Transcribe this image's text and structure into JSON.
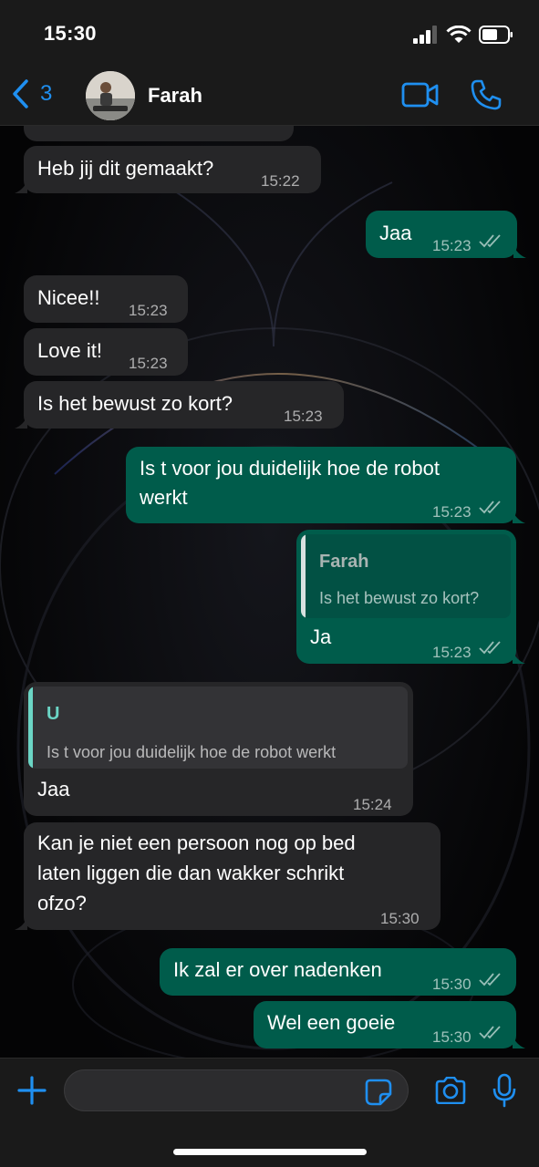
{
  "status_bar": {
    "time": "15:30"
  },
  "header": {
    "back_count": "3",
    "contact_name": "Farah"
  },
  "messages": [
    {
      "dir": "in",
      "text": "Heb jij dit gemaakt?",
      "time": "15:22"
    },
    {
      "dir": "out",
      "text": "Jaa",
      "time": "15:23"
    },
    {
      "dir": "in",
      "text": "Nicee!!",
      "time": "15:23"
    },
    {
      "dir": "in",
      "text": "Love it!",
      "time": "15:23"
    },
    {
      "dir": "in",
      "text": "Is het bewust zo kort?",
      "time": "15:23"
    },
    {
      "dir": "out",
      "text_line1": "Is t voor jou duidelijk hoe de robot",
      "text_line2": "werkt",
      "time": "15:23"
    },
    {
      "dir": "out",
      "quote_name": "Farah",
      "quote_text": "Is het bewust zo kort?",
      "text": "Ja",
      "time": "15:23"
    },
    {
      "dir": "in",
      "quote_name": "U",
      "quote_text": "Is t voor jou duidelijk hoe de robot werkt",
      "text": "Jaa",
      "time": "15:24"
    },
    {
      "dir": "in",
      "text_line1": "Kan je niet een persoon nog op bed",
      "text_line2": "laten liggen die dan wakker schrikt",
      "text_line3": "ofzo?",
      "time": "15:30"
    },
    {
      "dir": "out",
      "text": "Ik zal er over nadenken",
      "time": "15:30"
    },
    {
      "dir": "out",
      "text": "Wel een goeie",
      "time": "15:30"
    }
  ],
  "input": {
    "value": ""
  },
  "colors": {
    "accent": "#1f8ff0",
    "outgoing": "#005c4b",
    "incoming": "#262628",
    "quote_me": "#53bdeb",
    "quote_you": "#6bd5c5"
  }
}
